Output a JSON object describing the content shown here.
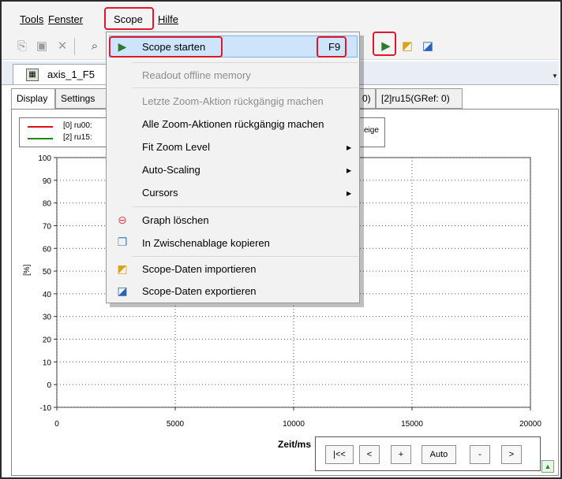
{
  "menubar": {
    "tools": "Tools",
    "fenster": "Fenster",
    "scope": "Scope",
    "hilfe": "Hilfe"
  },
  "toolbar": {
    "icons": [
      "copy-icon",
      "paste-icon",
      "delete-icon",
      "find-icon",
      "scope-start-icon",
      "scope-import-icon",
      "scope-export-icon"
    ]
  },
  "doc_tab": {
    "label": "axis_1_F5"
  },
  "subtabs": {
    "display": "Display",
    "settings": "Settings",
    "tab3_partial": "0)",
    "tab4": "[2]ru15(GRef: 0)"
  },
  "legend": {
    "items": [
      {
        "label": "[0] ru00:",
        "color": "#e01010"
      },
      {
        "label": "[2] ru15:",
        "color": "#1a8a1a"
      }
    ],
    "extra": "eige"
  },
  "chart_data": {
    "type": "line",
    "title": "",
    "xlabel": "Zeit/ms",
    "ylabel": "[%]",
    "xlim": [
      0,
      20000
    ],
    "ylim": [
      -10,
      100
    ],
    "x_ticks": [
      "0",
      "5000",
      "10000",
      "15000",
      "20000"
    ],
    "y_ticks": [
      "100",
      "90",
      "80",
      "70",
      "60",
      "50",
      "40",
      "30",
      "20",
      "10",
      "0",
      "-10"
    ],
    "grid": true,
    "series": [
      {
        "name": "[0] ru00:",
        "x": [],
        "y": []
      },
      {
        "name": "[2] ru15:",
        "x": [],
        "y": []
      }
    ]
  },
  "nav_buttons": [
    "|<<",
    "<",
    "+",
    "Auto",
    "-",
    ">"
  ],
  "corner_icon": "arrow-up-icon",
  "scope_menu": {
    "items": [
      {
        "label": "Scope starten",
        "shortcut": "F9",
        "enabled": true,
        "highlighted": true,
        "icon": "scope-start-icon"
      },
      {
        "label": "Readout offline memory",
        "enabled": false
      },
      {
        "label": "Letzte Zoom-Aktion rückgängig machen",
        "enabled": false
      },
      {
        "label": "Alle Zoom-Aktionen rückgängig machen",
        "enabled": true
      },
      {
        "label": "Fit Zoom Level",
        "enabled": true,
        "submenu": true
      },
      {
        "label": "Auto-Scaling",
        "enabled": true,
        "submenu": true
      },
      {
        "label": "Cursors",
        "enabled": true,
        "submenu": true
      },
      {
        "label": "Graph löschen",
        "enabled": true,
        "icon": "delete-graph-icon"
      },
      {
        "label": "In Zwischenablage kopieren",
        "enabled": true,
        "icon": "clipboard-icon"
      },
      {
        "label": "Scope-Daten importieren",
        "enabled": true,
        "icon": "scope-import-icon"
      },
      {
        "label": "Scope-Daten exportieren",
        "enabled": true,
        "icon": "scope-export-icon"
      }
    ]
  },
  "colors": {
    "highlight": "#cde4fb",
    "annotation_red": "#e0182c"
  }
}
